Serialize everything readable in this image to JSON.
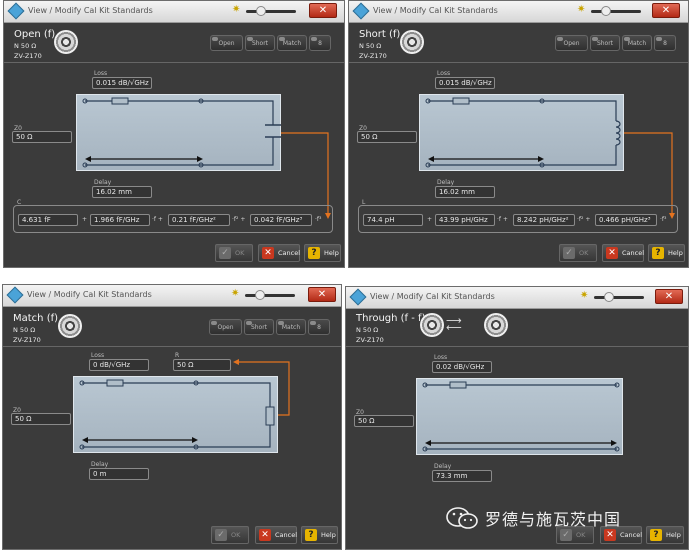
{
  "windows": [
    {
      "title": "View / Modify Cal Kit Standards",
      "name": "Open (f)",
      "impedance": "N 50 Ω",
      "kit": "ZV-Z170",
      "tabs": [
        "Open",
        "Short",
        "Match",
        "8"
      ],
      "loss_label": "Loss",
      "loss_value": "0.015 dB/√GHz",
      "z0_label": "Z0",
      "z0_value": "50 Ω",
      "delay_label": "Delay",
      "delay_value": "16.02 mm",
      "coef_label": "C",
      "coefficients": [
        "4.631 fF",
        "1.966 fF/GHz",
        "0.21 fF/GHz²",
        "0.042 fF/GHz³"
      ],
      "powers": [
        "·f +",
        "·f² +",
        "·f³"
      ],
      "ok_label": "OK",
      "cancel_label": "Cancel",
      "help_label": "Help"
    },
    {
      "title": "View / Modify Cal Kit Standards",
      "name": "Short (f)",
      "impedance": "N 50 Ω",
      "kit": "ZV-Z170",
      "tabs": [
        "Open",
        "Short",
        "Match",
        "8"
      ],
      "loss_label": "Loss",
      "loss_value": "0.015 dB/√GHz",
      "z0_label": "Z0",
      "z0_value": "50 Ω",
      "delay_label": "Delay",
      "delay_value": "16.02 mm",
      "coef_label": "L",
      "coefficients": [
        "74.4 pH",
        "43.99 pH/GHz",
        "8.242 pH/GHz²",
        "0.466 pH/GHz³"
      ],
      "powers": [
        "·f +",
        "·f² +",
        "·f³"
      ],
      "ok_label": "OK",
      "cancel_label": "Cancel",
      "help_label": "Help"
    },
    {
      "title": "View / Modify Cal Kit Standards",
      "name": "Match (f)",
      "impedance": "N 50 Ω",
      "kit": "ZV-Z170",
      "tabs": [
        "Open",
        "Short",
        "Match",
        "8"
      ],
      "loss_label": "Loss",
      "loss_value": "0 dB/√GHz",
      "r_label": "R",
      "r_value": "50 Ω",
      "z0_label": "Z0",
      "z0_value": "50 Ω",
      "delay_label": "Delay",
      "delay_value": "0 m",
      "ok_label": "OK",
      "cancel_label": "Cancel",
      "help_label": "Help"
    },
    {
      "title": "View / Modify Cal Kit Standards",
      "name": "Through (f - f)",
      "impedance": "N 50 Ω",
      "kit": "ZV-Z170",
      "loss_label": "Loss",
      "loss_value": "0.02 dB/√GHz",
      "z0_label": "Z0",
      "z0_value": "50 Ω",
      "delay_label": "Delay",
      "delay_value": "73.3 mm",
      "ok_label": "OK",
      "cancel_label": "Cancel",
      "help_label": "Help"
    }
  ],
  "watermark": "罗德与施瓦茨中国",
  "colors": {
    "accent_orange": "#e4731f",
    "close_red": "#c9381f",
    "help_yellow": "#e6b400"
  }
}
